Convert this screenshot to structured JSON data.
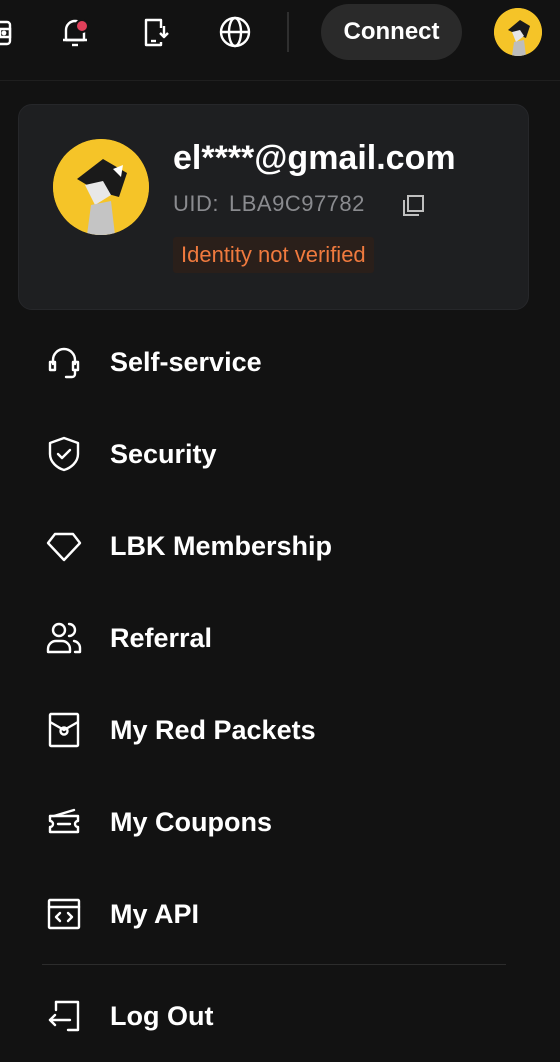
{
  "topbar": {
    "connect_label": "Connect",
    "icons": [
      "wallet-icon",
      "notification-bell-icon",
      "download-app-icon",
      "globe-icon"
    ],
    "notification_dot_color": "#e0405a"
  },
  "profile": {
    "email": "el****@gmail.com",
    "uid_label": "UID:",
    "uid_value": "LBA9C97782",
    "verification_status": "Identity not verified",
    "verification_color": "#f07a3e",
    "avatar_color": "#f5c428"
  },
  "menu": {
    "items": [
      {
        "label": "Self-service",
        "icon": "headset-icon"
      },
      {
        "label": "Security",
        "icon": "shield-check-icon"
      },
      {
        "label": "LBK Membership",
        "icon": "diamond-icon"
      },
      {
        "label": "Referral",
        "icon": "users-icon"
      },
      {
        "label": "My Red Packets",
        "icon": "red-packet-icon"
      },
      {
        "label": "My Coupons",
        "icon": "coupon-icon"
      },
      {
        "label": "My API",
        "icon": "api-icon"
      }
    ],
    "logout_label": "Log Out"
  }
}
